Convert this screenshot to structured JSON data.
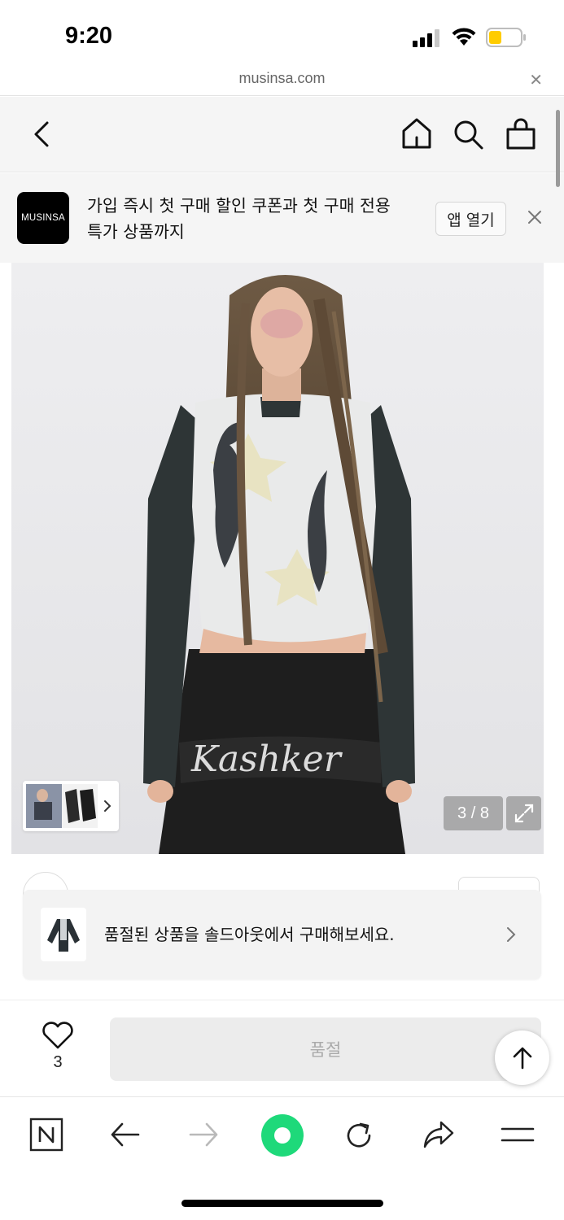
{
  "status_bar": {
    "time": "9:20"
  },
  "url_bar": {
    "domain": "musinsa.com"
  },
  "site_header": {
    "icons": [
      "back-icon",
      "home-icon",
      "search-icon",
      "shopping-bag-icon"
    ]
  },
  "banner": {
    "logo_text": "MUSINSA",
    "line1": "가입 즉시 첫 구매 할인 쿠폰과 첫 구매 전용",
    "line2": "특가 상품까지",
    "open_app_label": "앱 열기"
  },
  "hero": {
    "image_counter": "3 / 8",
    "thumbnail_strip": "thumbnail-strip"
  },
  "sold_out_toast": {
    "message": "품절된 상품을 솔드아웃에서 구매해보세요."
  },
  "buy_bar": {
    "like_count": "3",
    "sold_out_label": "품절"
  },
  "colors": {
    "accent_green": "#1ed97a",
    "battery_yellow": "#ffcc00",
    "toast_bg": "#f3f3f3"
  }
}
